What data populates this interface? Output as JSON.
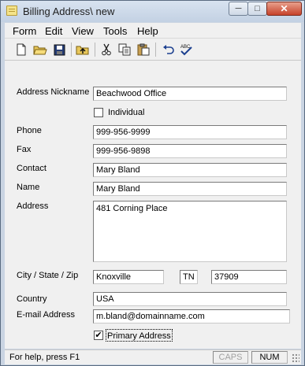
{
  "window": {
    "title": "Billing Address\\ new",
    "min_glyph": "─",
    "max_glyph": "□",
    "close_glyph": "✕"
  },
  "menu": [
    "Form",
    "Edit",
    "View",
    "Tools",
    "Help"
  ],
  "toolbar_icons": [
    "new-file-icon",
    "open-folder-icon",
    "save-icon",
    "go-up-icon",
    "cut-icon",
    "copy-icon",
    "paste-icon",
    "undo-icon",
    "spellcheck-icon"
  ],
  "form": {
    "nickname_label": "Address Nickname",
    "nickname": "Beachwood Office",
    "individual_label": "Individual",
    "individual_checked": false,
    "phone_label": "Phone",
    "phone": "999-956-9999",
    "fax_label": "Fax",
    "fax": "999-956-9898",
    "contact_label": "Contact",
    "contact": "Mary Bland",
    "name_label": "Name",
    "name": "Mary Bland",
    "address_label": "Address",
    "address": "481 Corning Place",
    "csz_label": "City / State / Zip",
    "city": "Knoxville",
    "state": "TN",
    "zip": "37909",
    "country_label": "Country",
    "country": "USA",
    "email_label": "E-mail Address",
    "email": "m.bland@domainname.com",
    "primary_label": "Primary Address",
    "primary_checked": true,
    "check_glyph": "✔"
  },
  "status": {
    "help": "For help, press F1",
    "caps": "CAPS",
    "num": "NUM"
  }
}
